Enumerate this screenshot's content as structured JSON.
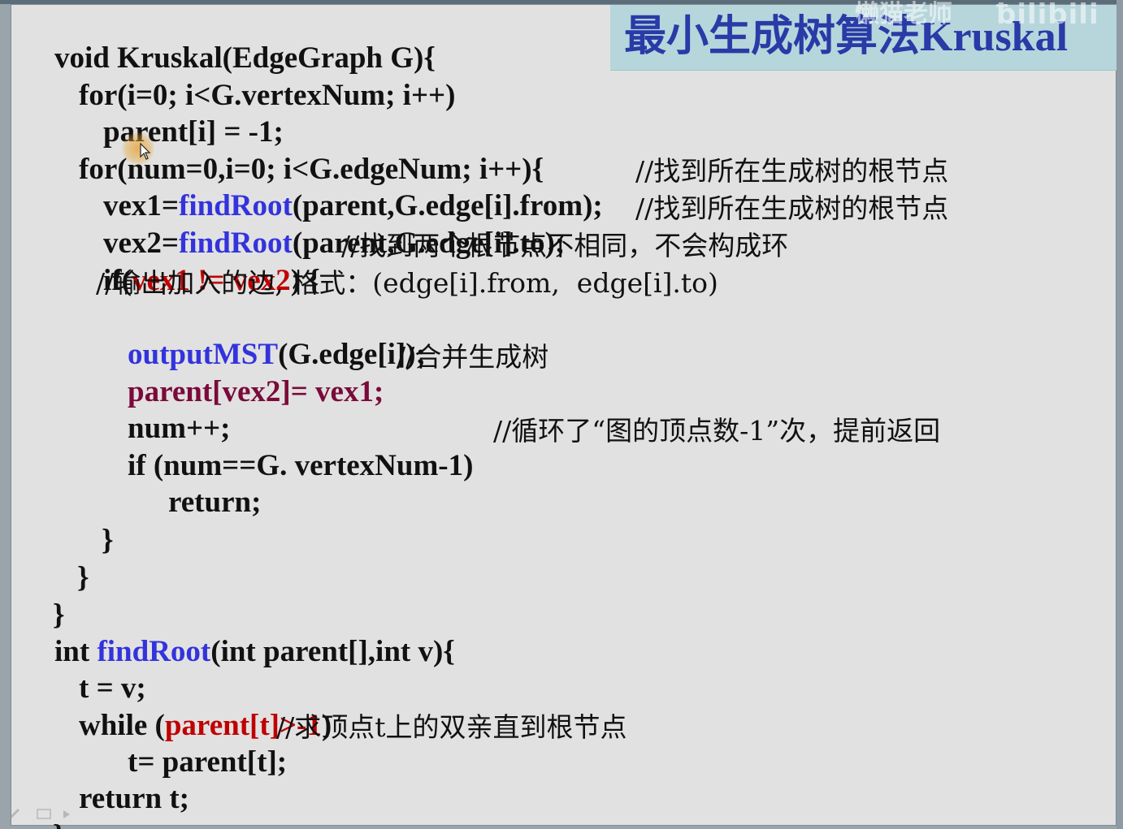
{
  "title": "最小生成树算法Kruskal",
  "watermark": "懒猫老师",
  "watermark_logo": "bilibili",
  "accent_colors": {
    "function": "#3333dd",
    "highlight_red": "#c00000",
    "highlight_maroon": "#7a0a3a",
    "title": "#2a3aa6",
    "title_bg": "#b6d6dc"
  },
  "code": {
    "l1": "void Kruskal(EdgeGraph G){",
    "l2": "for(i=0; i<G.vertexNum; i++)",
    "l3": "parent[i] = -1;",
    "l4": "for(num=0,i=0; i<G.edgeNum; i++){",
    "l5_a": "vex1=",
    "l5_fn": "findRoot",
    "l5_b": "(parent,G.edge[i].from);",
    "l5_cm": "//找到所在生成树的根节点",
    "l6_a": "vex2=",
    "l6_fn": "findRoot",
    "l6_b": "(parent,G.edge[i].to);",
    "l6_cm": "//找到所在生成树的根节点",
    "l7_a": "if(",
    "l7_cond": "vex1 != vex2",
    "l7_b": ") {",
    "l7_cm": "//找到两个根节点不相同，不会构成环",
    "l8_cm": "//输出加入的边, 格式：(edge[i].from,  edge[i].to)",
    "l9_fn": "outputMST",
    "l9_b": "(G.edge[i]);",
    "l10_a": "parent[vex2]= vex1;",
    "l10_cm": "//合并生成树",
    "l11": "num++;",
    "l12_a": "if (num==G. vertexNum-1)",
    "l12_cm": "//循环了“图的顶点数-1”次，提前返回",
    "l13": "return;",
    "l14": "}",
    "l15": "}",
    "l16": "}",
    "l17_a": "int ",
    "l17_fn": "findRoot",
    "l17_b": "(int parent[],int v){",
    "l18": "t = v;",
    "l19_a": "while (",
    "l19_cond": "parent[t]>-1",
    "l19_b": ")",
    "l20_a": "t= parent[t];",
    "l20_cm": "//求顶点t上的双亲直到根节点",
    "l21": "return t;",
    "l22": "}"
  }
}
